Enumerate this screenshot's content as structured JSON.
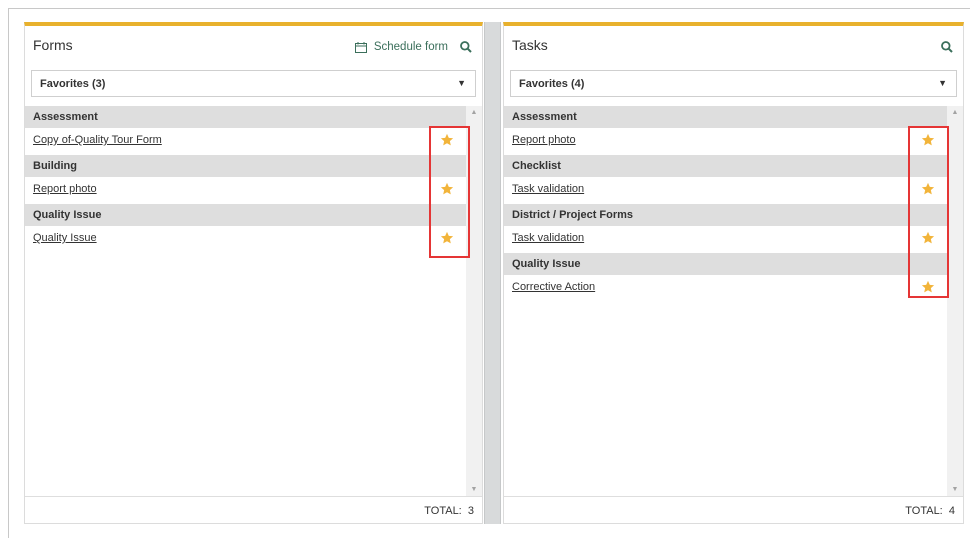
{
  "forms": {
    "title": "Forms",
    "schedule_label": "Schedule form",
    "dropdown_value": "Favorites (3)",
    "groups": [
      {
        "name": "Assessment",
        "items": [
          "Copy of-Quality Tour Form"
        ]
      },
      {
        "name": "Building",
        "items": [
          "Report photo"
        ]
      },
      {
        "name": "Quality Issue",
        "items": [
          "Quality Issue"
        ]
      }
    ],
    "total_label": "TOTAL:",
    "total_value": "3"
  },
  "tasks": {
    "title": "Tasks",
    "dropdown_value": "Favorites (4)",
    "groups": [
      {
        "name": "Assessment",
        "items": [
          "Report photo"
        ]
      },
      {
        "name": "Checklist",
        "items": [
          "Task validation"
        ]
      },
      {
        "name": "District / Project Forms",
        "items": [
          "Task validation"
        ]
      },
      {
        "name": "Quality Issue",
        "items": [
          "Corrective Action"
        ]
      }
    ],
    "total_label": "TOTAL:",
    "total_value": "4"
  },
  "colors": {
    "accent": "#e8b12d",
    "star": "#f2b43a",
    "highlight": "#e53535",
    "link_green": "#3b6f5b",
    "group_bg": "#dedede"
  },
  "icons": {
    "search": "search-icon",
    "calendar": "calendar-icon",
    "star": "star-icon",
    "dropdown": "chevron-down-icon"
  }
}
